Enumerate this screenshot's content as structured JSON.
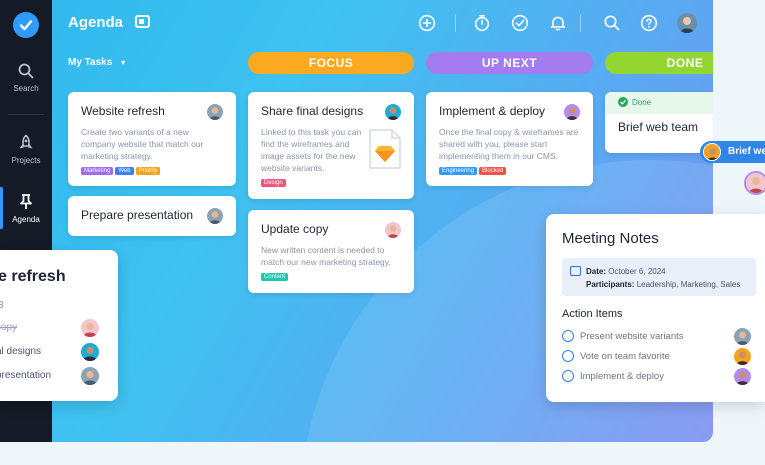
{
  "app": {
    "title": "Agenda"
  },
  "sidebar": {
    "items": [
      {
        "label": "Search",
        "icon": "search-icon"
      },
      {
        "label": "Projects",
        "icon": "rocket-icon"
      },
      {
        "label": "Agenda",
        "icon": "pin-icon"
      }
    ]
  },
  "toolbar": {
    "icons": [
      "add-icon",
      "timer-icon",
      "check-circle-icon",
      "bell-icon",
      "search-icon",
      "help-icon",
      "user-avatar"
    ]
  },
  "filter": {
    "label": "My Tasks"
  },
  "columns": [
    {
      "label": "FOCUS",
      "color": "#fbaa1f"
    },
    {
      "label": "UP NEXT",
      "color": "#a57bf0"
    },
    {
      "label": "DONE",
      "color": "#93d630"
    }
  ],
  "cards": {
    "website_refresh": {
      "title": "Website refresh",
      "desc": "Create two variants of a new company website that match our marketing strategy.",
      "tags": [
        {
          "label": "Marketing",
          "color": "#9b6cf0"
        },
        {
          "label": "Web",
          "color": "#3d7ef0"
        },
        {
          "label": "Priority",
          "color": "#f7a21f"
        }
      ]
    },
    "prepare_presentation": {
      "title": "Prepare presentation"
    },
    "share_final_designs": {
      "title": "Share final designs",
      "desc": "Linked to this task you can find the wireframes and image assets for the new website variants.",
      "tags": [
        {
          "label": "Design",
          "color": "#f0557a"
        }
      ]
    },
    "update_copy": {
      "title": "Update copy",
      "desc": "New written content is needed to match our new marketing strategy.",
      "tags": [
        {
          "label": "Content",
          "color": "#1fc6b0"
        }
      ]
    },
    "implement_deploy": {
      "title": "Implement & deploy",
      "desc": "Once the final copy & wireframes are shared with you, please start implementing them in our CMS.",
      "tags": [
        {
          "label": "Engineering",
          "color": "#2f9bff"
        },
        {
          "label": "Blocked",
          "color": "#f0514b"
        }
      ]
    },
    "brief_web_team": {
      "status": "Done",
      "title": "Brief web team"
    }
  },
  "left_panel": {
    "title": "e refresh",
    "count": "3",
    "rows": [
      {
        "label": "copy",
        "struck": true
      },
      {
        "label": "al designs"
      },
      {
        "label": "presentation"
      }
    ]
  },
  "meeting": {
    "title": "Meeting Notes",
    "date_label": "Date:",
    "date_value": "October 6, 2024",
    "participants_label": "Participants:",
    "participants_value": "Leadership, Marketing, Sales",
    "action_heading": "Action Items",
    "items": [
      "Present website variants",
      "Vote on team favorite",
      "Implement & deploy"
    ]
  },
  "brief_pill": {
    "label": "Brief web team"
  }
}
